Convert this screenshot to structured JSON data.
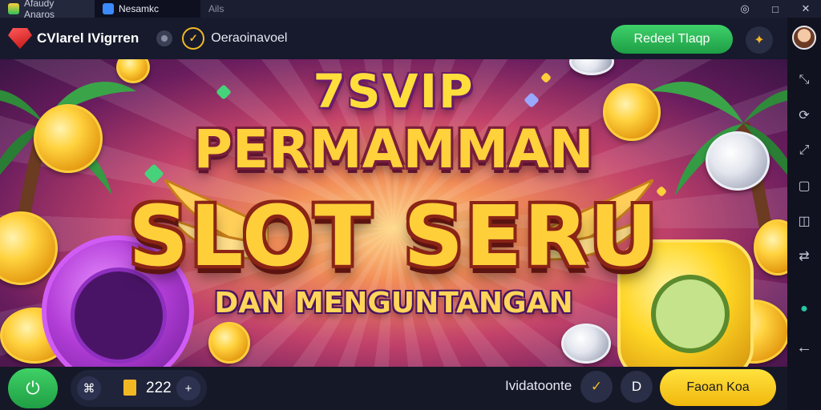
{
  "window_tabs": [
    {
      "label": "Afaudy Anaros"
    },
    {
      "label": "Nesamkc"
    },
    {
      "label": "Ails"
    }
  ],
  "window_controls": {
    "minimize": "◎",
    "maximize": "□",
    "close": "✕"
  },
  "toolbar": {
    "brand": "CVlarel IVigrren",
    "nav_label": "Oeraoinavoel",
    "green_button": "Redeel Tlaqp"
  },
  "banner": {
    "line1": "7SVIP",
    "line2": "PERMAMMAN",
    "line3": "SLOT SERU",
    "line4": "DAN MENGUNTANGAN"
  },
  "bottom": {
    "ticket_count": "222",
    "label": "Ividatoonte",
    "right_button": "Faoan Koa",
    "d_badge": "D"
  },
  "colors": {
    "accent_green": "#2fbf57",
    "accent_yellow": "#f5c518",
    "bg": "#14172a"
  }
}
